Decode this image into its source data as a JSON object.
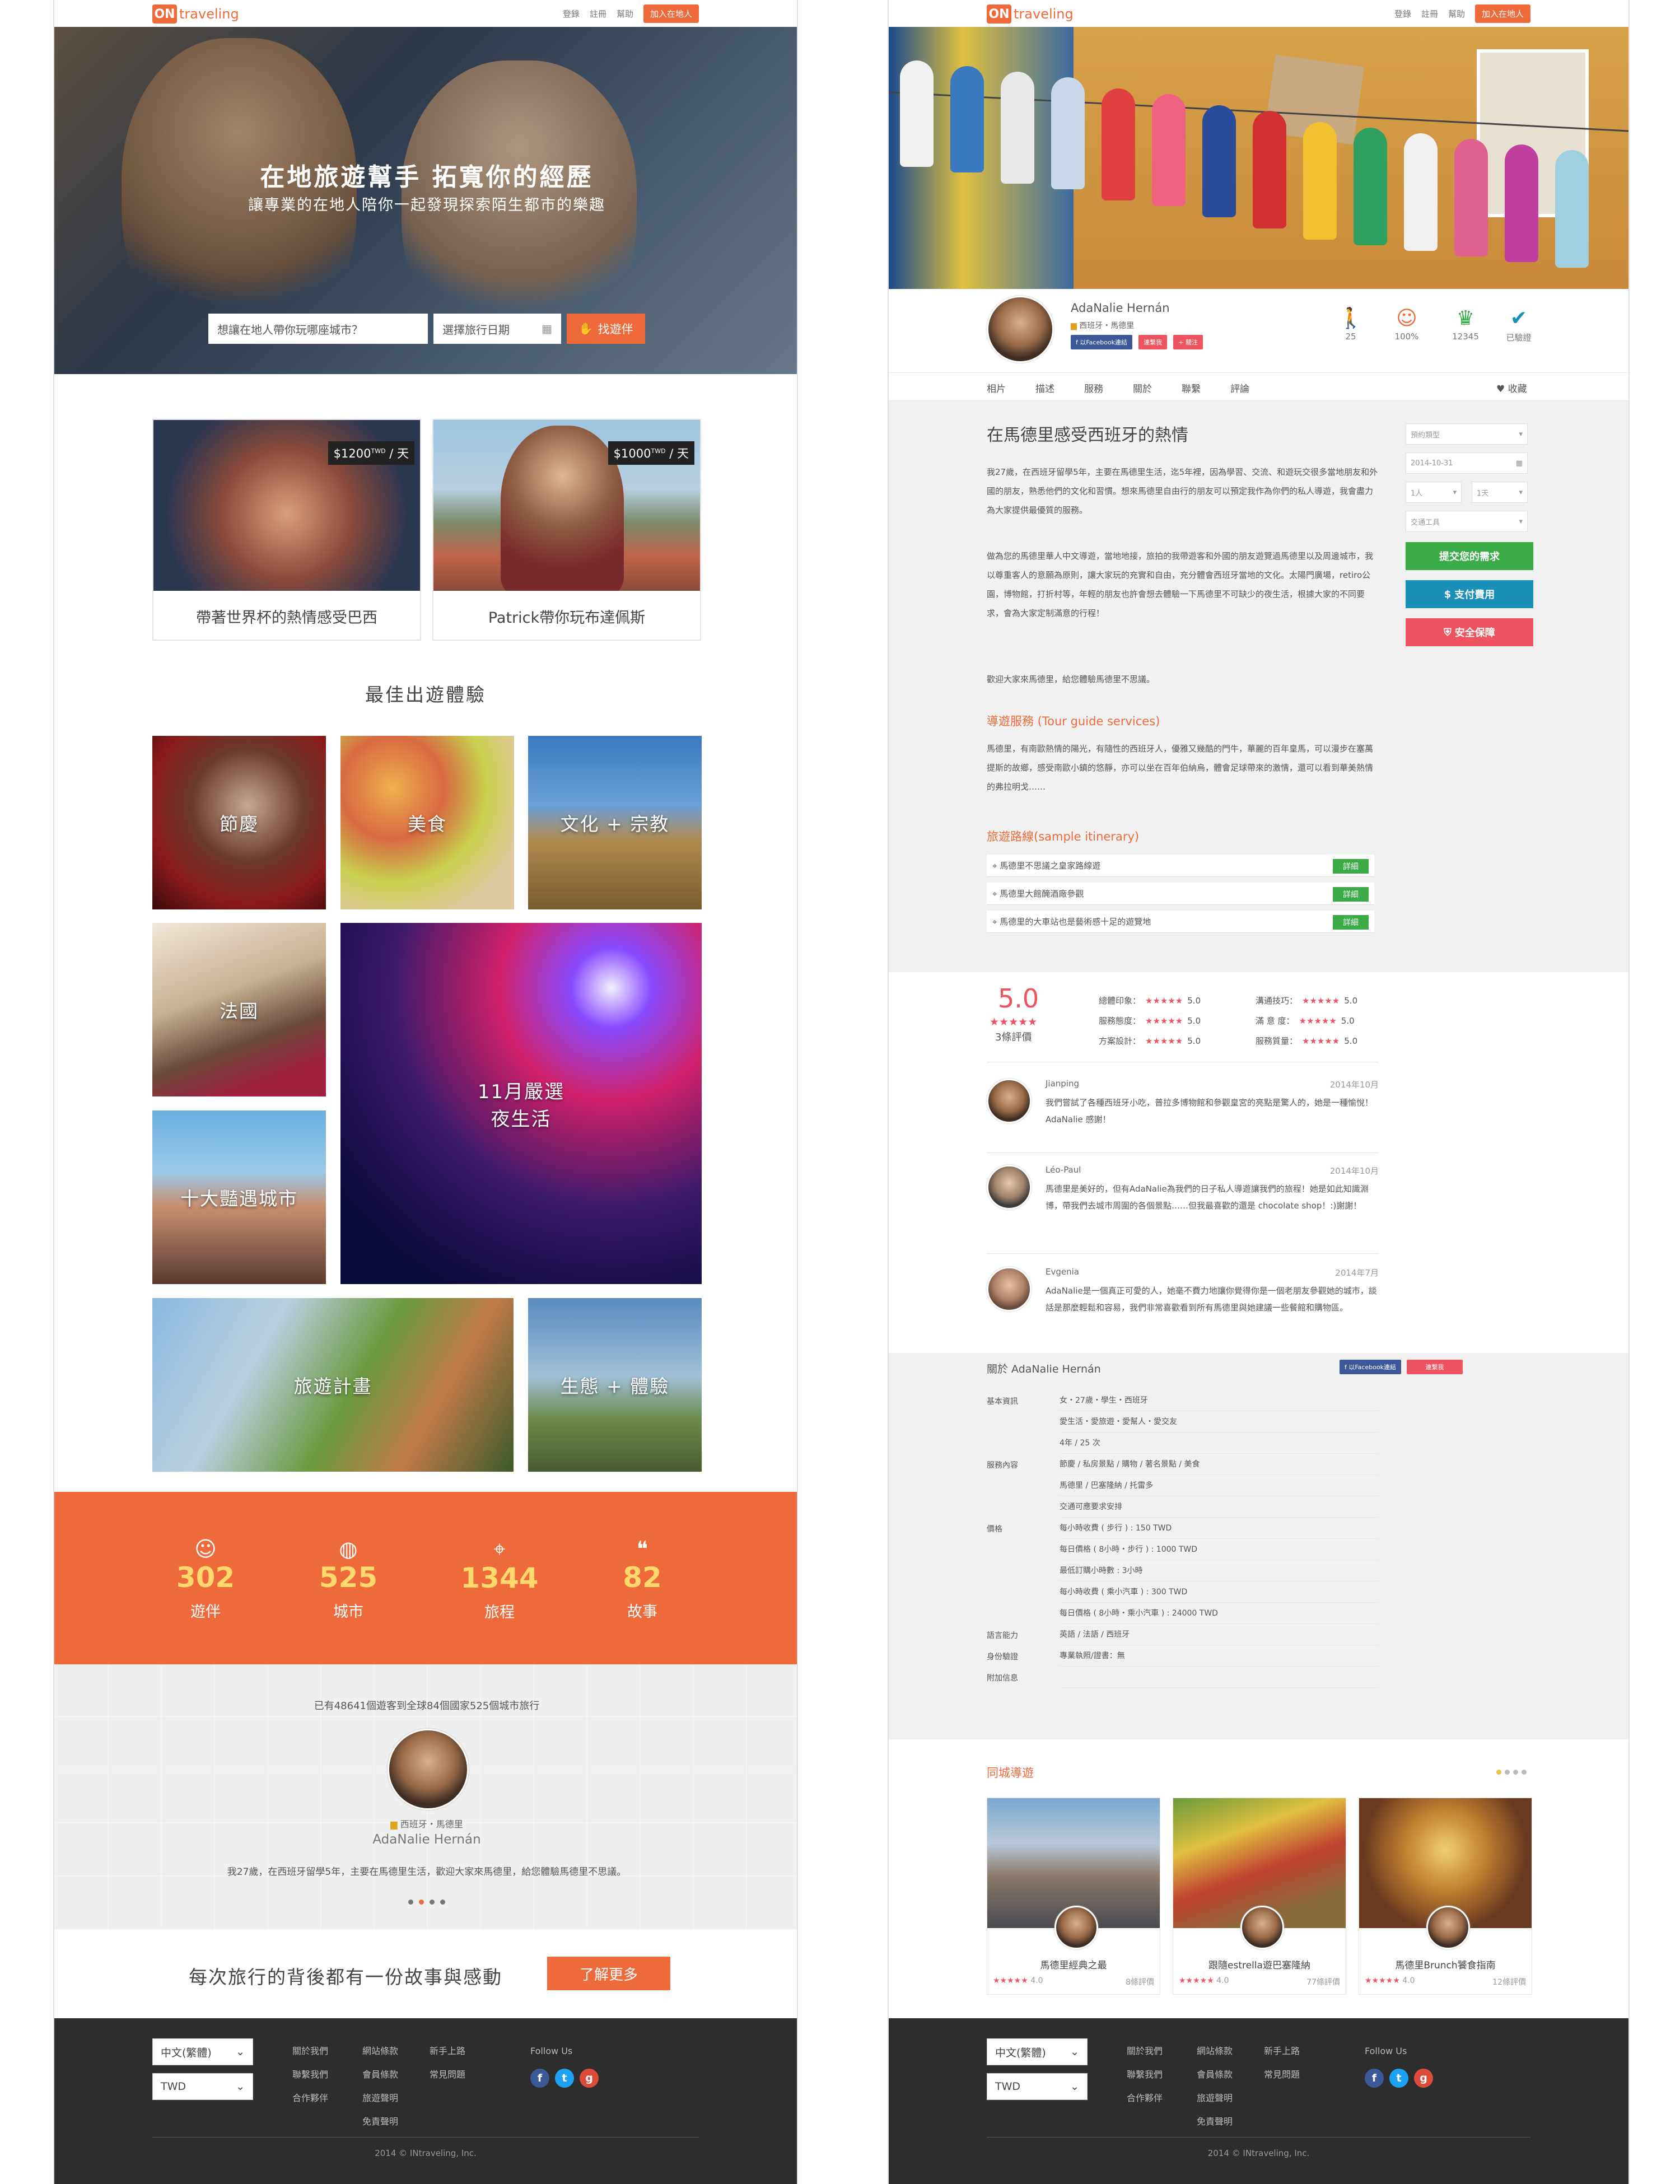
{
  "brand": {
    "mark": "ON",
    "name": "traveling",
    "accent": "#ef6a3a"
  },
  "nav": {
    "login": "登錄",
    "register": "註冊",
    "help": "幫助",
    "join": "加入在地人"
  },
  "home": {
    "hero": {
      "title": "在地旅遊幫手 拓寬你的經歷",
      "subtitle": "讓專業的在地人陪你一起發現探索陌生都市的樂趣",
      "city_placeholder": "想讓在地人帶你玩哪座城市？",
      "date_placeholder": "選擇旅行日期",
      "search_button": "找遊伴"
    },
    "featured": [
      {
        "price": "$1200",
        "unit_sup": "TWD",
        "unit": "/ 天",
        "caption": "帶著世界杯的熱情感受巴西"
      },
      {
        "price": "$1000",
        "unit_sup": "TWD",
        "unit": "/ 天",
        "caption": "Patrick帶你玩布達佩斯"
      }
    ],
    "best_title": "最佳出遊體驗",
    "categories": [
      "節慶",
      "美食",
      "文化 + 宗教",
      "法國",
      "11月嚴選\n夜生活",
      "十大豔遇城市",
      "旅遊計畫",
      "生態 + 體驗"
    ],
    "stats": [
      {
        "num": "302",
        "label": "遊伴",
        "icon": "person-icon"
      },
      {
        "num": "525",
        "label": "城市",
        "icon": "globe-icon"
      },
      {
        "num": "1344",
        "label": "旅程",
        "icon": "pin-icon"
      },
      {
        "num": "82",
        "label": "故事",
        "icon": "chat-icon"
      }
    ],
    "testimonial": {
      "headline": "已有48641個遊客到全球84個國家525個城市旅行",
      "location": "西班牙・馬德里",
      "name": "AdaNalie Hernán",
      "quote": "我27歲，在西班牙留學5年，主要在馬德里生活，歡迎大家來馬德里，給您體驗馬德里不思議。"
    },
    "cta": {
      "text": "每次旅行的背後都有一份故事與感動",
      "button": "了解更多"
    }
  },
  "profile": {
    "name": "AdaNalie Hernán",
    "location": "西班牙・馬德里",
    "fb_button": "f 以Facebook連結",
    "contact_button": "連繫我",
    "follow_button": "+ 關注",
    "metrics": [
      {
        "value": "25",
        "icon": "walker-icon",
        "color": "#b04aa8"
      },
      {
        "value": "100%",
        "icon": "smile-icon",
        "color": "#ef6a3a"
      },
      {
        "value": "12345",
        "icon": "badge-icon",
        "color": "#3aab46"
      },
      {
        "value": "已驗證",
        "icon": "verified-icon",
        "color": "#1a8fb8"
      }
    ],
    "tabs": [
      "相片",
      "描述",
      "服務",
      "關於",
      "聯繫",
      "評論"
    ],
    "favorite": "收藏",
    "title": "在馬德里感受西班牙的熱情",
    "paragraphs": [
      "我27歲，在西班牙留學5年，主要在馬德里生活，迄5年裡，因為學習、交流、和遊玩交很多當地朋友和外國的朋友，熟悉他們的文化和習慣。想來馬德里自由行的朋友可以預定我作為你們的私人導遊，我會盡力為大家提供最優質的服務。",
      "做為您的馬德里華人中文導遊，當地地接，旅拍的我帶遊客和外國的朋友遊覽過馬德里以及周邊城市，我以尊重客人的意願為原則，讓大家玩的充實和自由，充分體會西班牙當地的文化。太陽門廣場，retiro公園，博物館，打折村等，年輕的朋友也許會想去體驗一下馬德里不可缺少的夜生活，根據大家的不同要求，會為大家定制滿意的行程！",
      "歡迎大家來馬德里，給您體驗馬德里不思議。"
    ],
    "guide_title": "導遊服務 (Tour guide services)",
    "guide_text": "馬德里，有南歐熱情的陽光，有隨性的西班牙人，優雅又幾酷的門牛，華麗的百年皇馬，可以漫步在塞萬提斯的故鄉，感受南歐小鎮的悠靜，亦可以坐在百年伯納烏，體會足球帶來的激情，還可以看到華美熱情的弗拉明戈……",
    "itinerary_title": "旅遊路線(sample itinerary)",
    "itinerary": [
      "馬德里不思議之皇家路線遊",
      "馬德里大館醃酒廠參觀",
      "馬德里的大車站也是藝術感十足的遊覽地"
    ],
    "detail_button": "詳細",
    "booking": {
      "type": "預約類型",
      "date": "2014-10-31",
      "people": "1人",
      "days": "1天",
      "transport": "交通工具",
      "submit": "提交您的需求",
      "pay": "支付費用",
      "safety": "安全保障"
    },
    "rating": {
      "score": "5.0",
      "count": "3條評價",
      "items": [
        {
          "label": "總體印象：",
          "value": "5.0"
        },
        {
          "label": "溝通技巧：",
          "value": "5.0"
        },
        {
          "label": "服務態度：",
          "value": "5.0"
        },
        {
          "label": "滿 意 度：",
          "value": "5.0"
        },
        {
          "label": "方案設計：",
          "value": "5.0"
        },
        {
          "label": "服務質量：",
          "value": "5.0"
        }
      ]
    },
    "reviews": [
      {
        "name": "Jianping",
        "date": "2014年10月",
        "text": "我們嘗試了各種西班牙小吃，普拉多博物館和參觀皇宮的亮點是驚人的，她是一種愉悅！AdaNalie 感謝！"
      },
      {
        "name": "Léo-Paul",
        "date": "2014年10月",
        "text": "馬德里是美好的，但有AdaNalie為我們的日子私人導遊讓我們的旅程！她是如此知識淵博，帶我們去城市周圍的各個景點……但我最喜歡的還是 chocolate shop！:)謝謝！"
      },
      {
        "name": "Evgenia",
        "date": "2014年7月",
        "text": "AdaNalie是一個真正可愛的人，她毫不費力地讓你覺得你是一個老朋友參觀她的城市，談話是那麼輕鬆和容易，我們非常喜歡看到所有馬德里與她建議一些餐館和購物區。"
      }
    ],
    "about": {
      "title": "關於 AdaNalie Hernán",
      "fb": "f 以Facebook連結",
      "contact": "連繫我",
      "rows": [
        {
          "key": "基本資訊",
          "values": [
            "女・27歲・學生・西班牙",
            "愛生活・愛旅遊・愛幫人・愛交友",
            "4年 / 25 次"
          ]
        },
        {
          "key": "服務內容",
          "values": [
            "節慶 / 私房景點 / 購物 / 著名景點 / 美食",
            "馬德里 / 巴塞隆納 / 托雷多",
            "交通可應要求安排"
          ]
        },
        {
          "key": "價格",
          "values": [
            "每小時收費 ( 步行 ) : 150 TWD",
            "每日價格 ( 8小時・步行 ) : 1000 TWD",
            "最低訂購小時數 : 3小時",
            "每小時收費 ( 乘小汽車 ) : 300 TWD",
            "每日價格 ( 8小時・乘小汽車 ) : 24000 TWD"
          ]
        },
        {
          "key": "語言能力",
          "values": [
            "英語 / 法語 / 西班牙"
          ]
        },
        {
          "key": "身份驗證",
          "values": [
            "專業執照/證書：無"
          ]
        },
        {
          "key": "附加信息",
          "values": [
            ""
          ]
        }
      ]
    },
    "same_city_title": "同城導遊",
    "guides": [
      {
        "name": "馬德里經典之最",
        "rating": "4.0",
        "reviews": "8條評價"
      },
      {
        "name": "跟隨estrella遊巴塞隆納",
        "rating": "4.0",
        "reviews": "77條評價"
      },
      {
        "name": "馬德里Brunch饕食指南",
        "rating": "4.0",
        "reviews": "12條評價"
      }
    ]
  },
  "footer": {
    "language": "中文(繁體)",
    "currency": "TWD",
    "col1": [
      "關於我們",
      "聯繫我們",
      "合作夥伴"
    ],
    "col2": [
      "網站條款",
      "會員條款",
      "旅遊聲明",
      "免責聲明"
    ],
    "col3": [
      "新手上路",
      "常見問題"
    ],
    "follow": "Follow Us",
    "copyright": "2014 © INtraveling, Inc."
  }
}
